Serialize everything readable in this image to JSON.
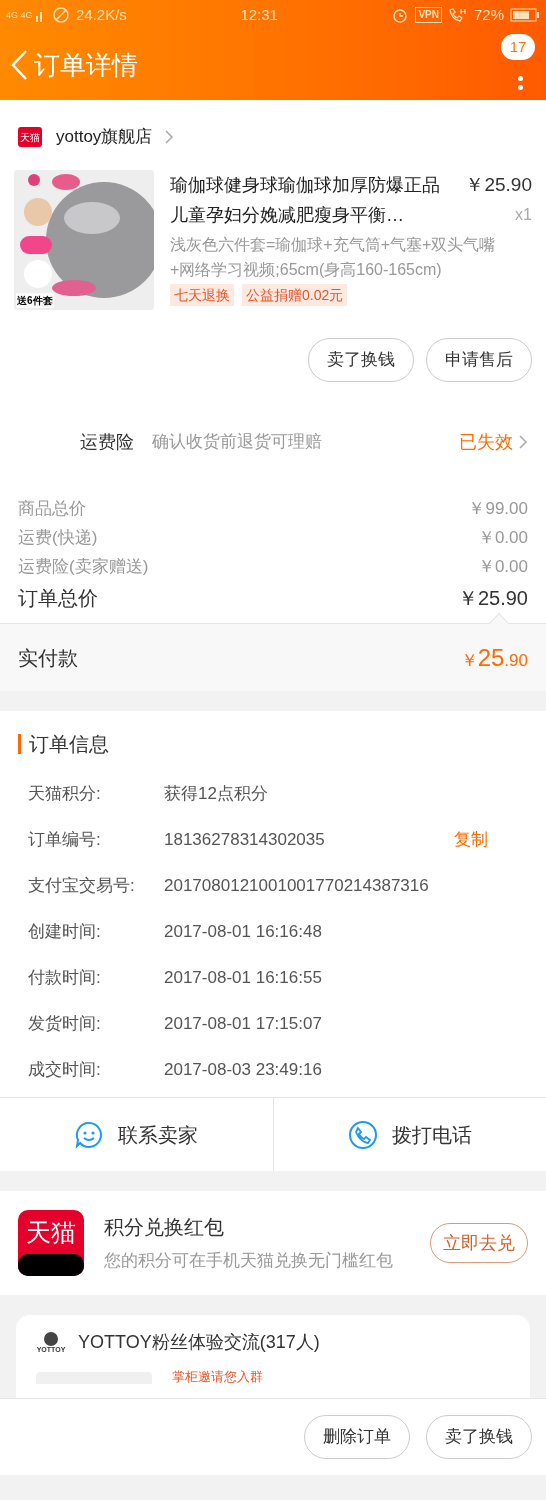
{
  "status_bar": {
    "network": "4G 4G",
    "speed": "24.2K/s",
    "time": "12:31",
    "vpn": "VPN",
    "battery": "72%"
  },
  "header": {
    "title": "订单详情",
    "badge": "17"
  },
  "store": {
    "name": "yottoy旗舰店",
    "logo": "天猫"
  },
  "product": {
    "title": "瑜伽球健身球瑜伽球加厚防爆正品儿童孕妇分娩减肥瘦身平衡…",
    "price": "￥25.90",
    "quantity": "x1",
    "sku": "浅灰色六件套=瑜伽球+充气筒+气塞+双头气嘴+网络学习视频;65cm(身高160-165cm)",
    "tags": [
      "七天退换",
      "公益捐赠0.02元"
    ],
    "image": {
      "kind": "picture",
      "caption": "送6件套"
    }
  },
  "item_buttons": [
    "卖了换钱",
    "申请售后"
  ],
  "insurance": {
    "label": "运费险",
    "description": "确认收货前退货可理赔",
    "status": "已失效"
  },
  "price_lines": [
    {
      "label": "商品总价",
      "value": "￥99.00"
    },
    {
      "label": "运费(快递)",
      "value": "￥0.00"
    },
    {
      "label": "运费险(卖家赠送)",
      "value": "￥0.00"
    }
  ],
  "order_total": {
    "label": "订单总价",
    "value": "￥25.90"
  },
  "paid": {
    "label": "实付款",
    "currency": "￥",
    "integer": "25",
    "decimal": ".90"
  },
  "order_info": {
    "title": "订单信息",
    "rows": [
      {
        "label": "天猫积分:",
        "value": "获得12点积分"
      },
      {
        "label": "订单编号:",
        "value": "18136278314302035",
        "action": "复制"
      },
      {
        "label": "支付宝交易号:",
        "value": "2017080121001001770214387316"
      },
      {
        "label": "创建时间:",
        "value": "2017-08-01 16:16:48"
      },
      {
        "label": "付款时间:",
        "value": "2017-08-01 16:16:55"
      },
      {
        "label": "发货时间:",
        "value": "2017-08-01 17:15:07"
      },
      {
        "label": "成交时间:",
        "value": "2017-08-03 23:49:16"
      }
    ]
  },
  "contact": [
    {
      "kind": "chat",
      "label": "联系卖家"
    },
    {
      "kind": "phone",
      "label": "拨打电话"
    }
  ],
  "promo": {
    "logo": "天猫",
    "title": "积分兑换红包",
    "subtitle": "您的积分可在手机天猫兑换无门槛红包",
    "button": "立即去兑"
  },
  "group": {
    "logo": "YOTTOY",
    "title": "YOTTOY粉丝体验交流(317人)",
    "invite": "掌柜邀请您入群"
  },
  "bottom_buttons": [
    "删除订单",
    "卖了换钱"
  ]
}
